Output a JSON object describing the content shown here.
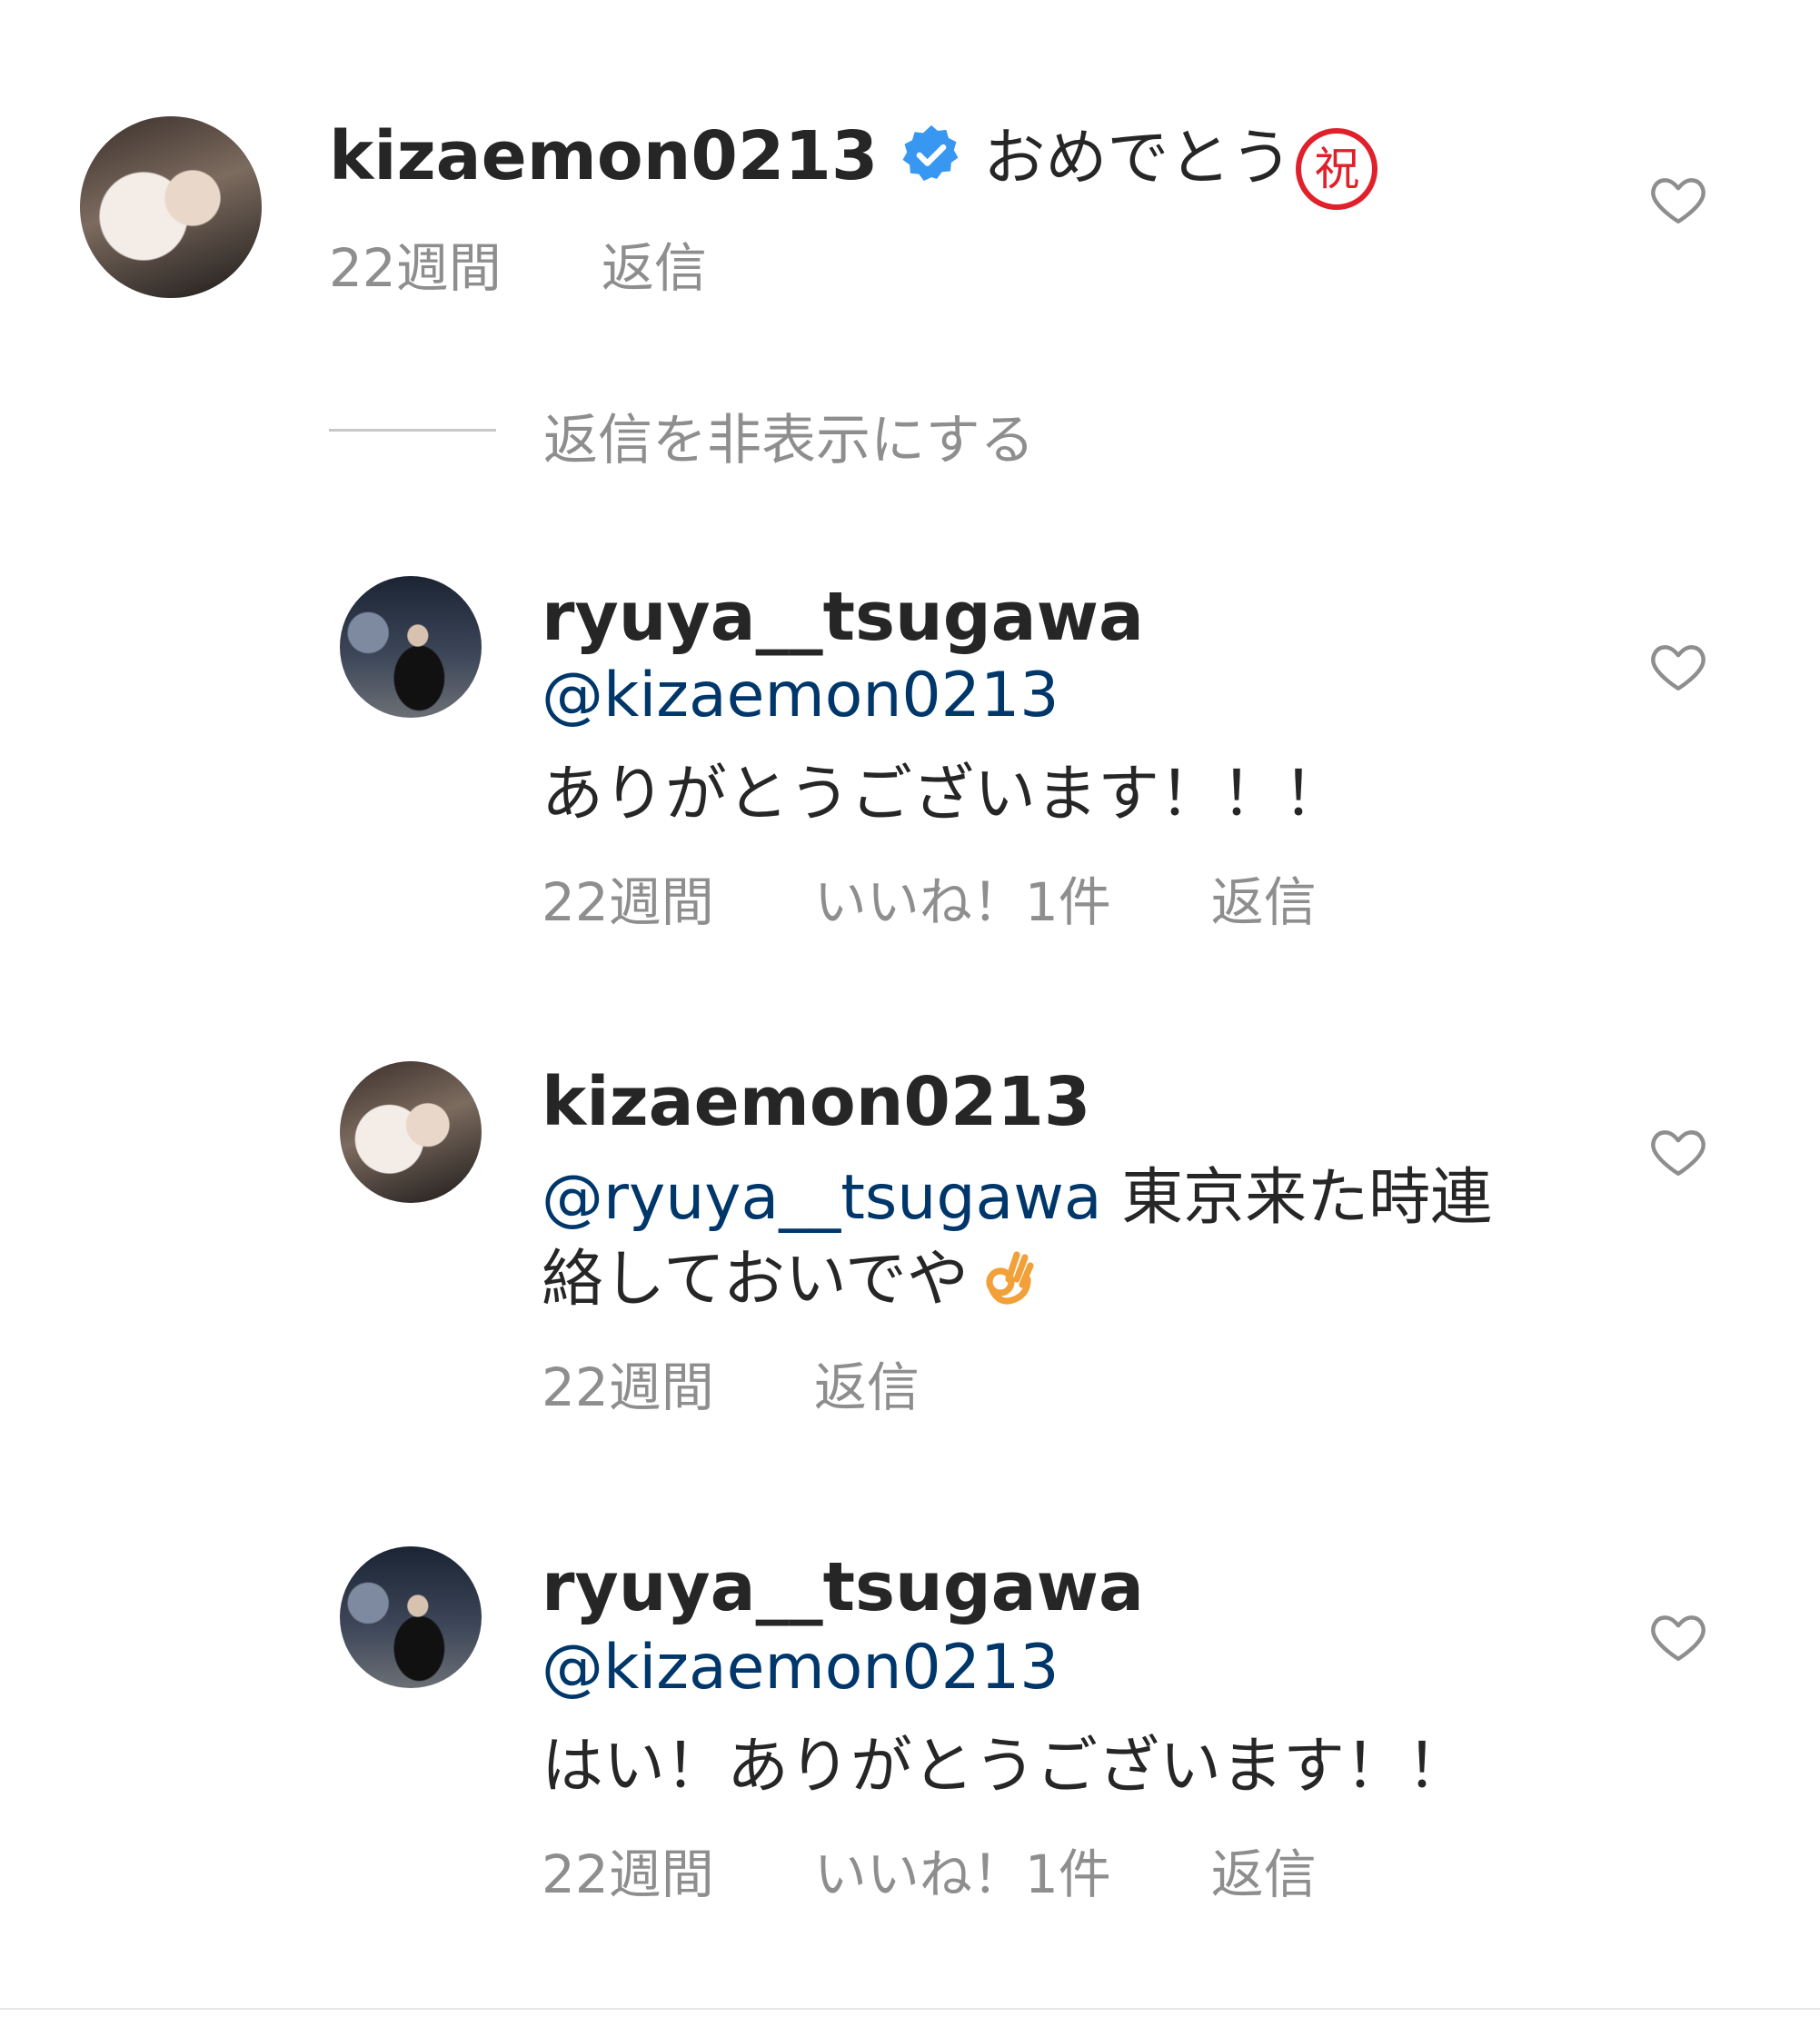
{
  "comments": [
    {
      "username": "kizaemon0213",
      "verified": true,
      "text": "おめでとう",
      "emoji": "祝",
      "time": "22週間",
      "reply": "返信"
    },
    {
      "username": "ryuya__tsugawa",
      "mention": "@kizaemon0213",
      "text": "ありがとうございます！！！",
      "time": "22週間",
      "likes": "いいね！1件",
      "reply": "返信"
    },
    {
      "username": "kizaemon0213",
      "mention": "@ryuya__tsugawa",
      "text_line1": "東京来た時連",
      "text_line2": "絡しておいでや",
      "emoji_icon": "ok-hand-icon",
      "time": "22週間",
      "reply": "返信"
    },
    {
      "username": "ryuya__tsugawa",
      "mention": "@kizaemon0213",
      "text": "はい！ありがとうございます！！",
      "time": "22週間",
      "likes": "いいね！1件",
      "reply": "返信"
    }
  ],
  "hide_replies": "返信を非表示にする",
  "colors": {
    "text": "#262626",
    "mention": "#00376b",
    "meta": "#8e8e8e",
    "verified": "#3897f0",
    "iwai": "#e0202a"
  }
}
